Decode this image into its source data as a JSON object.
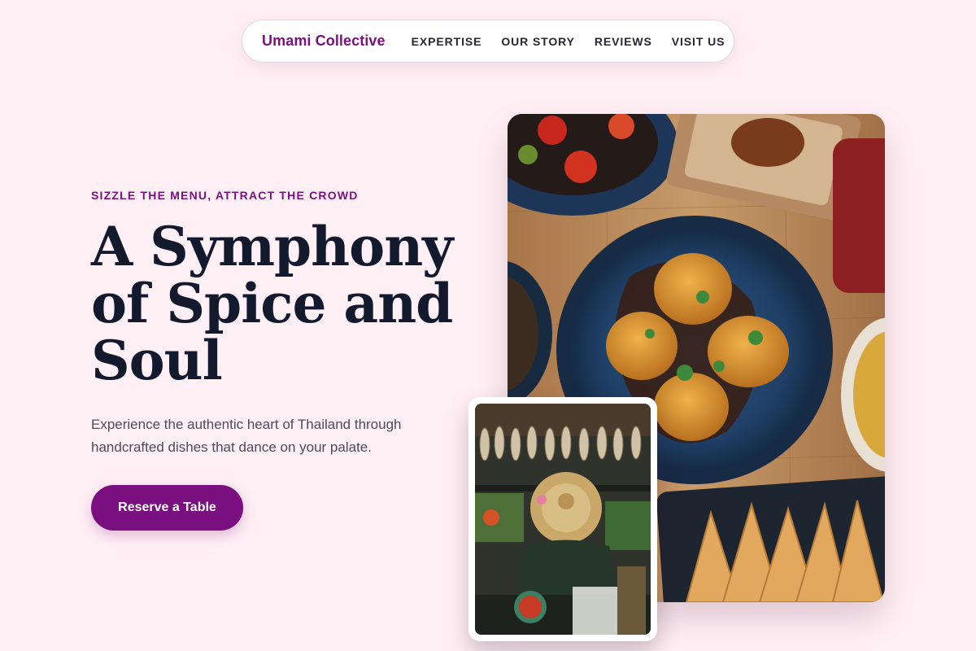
{
  "nav": {
    "brand": "Umami Collective",
    "links": [
      {
        "label": "EXPERTISE"
      },
      {
        "label": "OUR STORY"
      },
      {
        "label": "REVIEWS"
      },
      {
        "label": "VISIT US"
      }
    ]
  },
  "hero": {
    "eyebrow": "SIZZLE THE MENU, ATTRACT THE CROWD",
    "headline_lines": [
      "A Symphony",
      "of Spice and",
      "Soul"
    ],
    "subtext": "Experience the authentic heart of Thailand through handcrafted dishes that dance on your palate.",
    "cta_label": "Reserve a Table"
  },
  "colors": {
    "accent": "#7a0f7f",
    "background": "#fff0f5",
    "headline": "#141a2e"
  },
  "images": {
    "main": "thai-dishes-table-photo",
    "inset": "floating-market-vendor-photo"
  }
}
